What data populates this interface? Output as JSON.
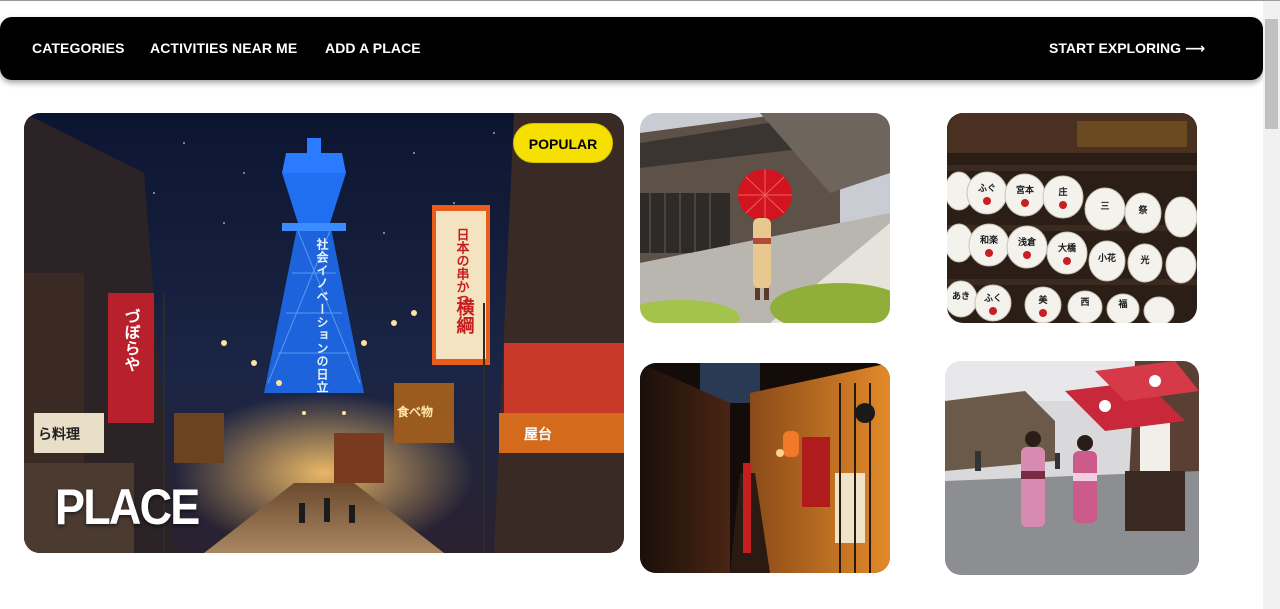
{
  "nav": {
    "links": [
      "CATEGORIES",
      "ACTIVITIES NEAR ME",
      "ADD A PLACE"
    ],
    "cta_label": "START EXPLORING",
    "cta_arrow": "⟶"
  },
  "featured": {
    "badge": "POPULAR",
    "title": "PLACE",
    "sign_text_1": "社会イノベーションの日立",
    "sign_text_2": "日本の串かつ",
    "sign_text_3": "横綱",
    "sign_text_4": "づぼらや",
    "sign_text_5": "ら料理",
    "sign_text_6": "屋台",
    "sign_text_7": "食べ物"
  },
  "lantern_card": {
    "lantern_labels": [
      "ふぐ",
      "宮本",
      "庄",
      "三",
      "祭",
      "和楽",
      "浅倉",
      "大橋",
      "小花",
      "光",
      "あき",
      "ふく",
      "美",
      "西",
      "福"
    ]
  },
  "colors": {
    "navbar": "#000000",
    "badge": "#f5e000",
    "tower_blue": "#1f6ff0"
  }
}
